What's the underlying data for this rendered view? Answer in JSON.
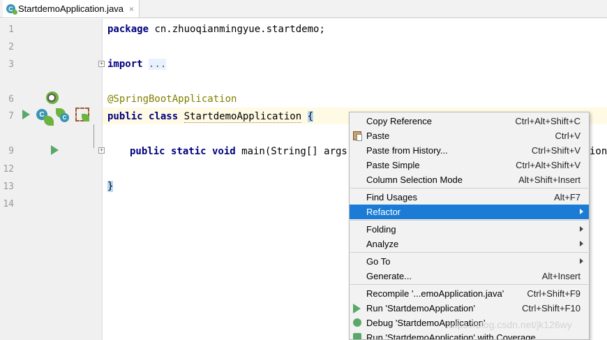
{
  "tab": {
    "title": "StartdemoApplication.java",
    "close": "×"
  },
  "line_numbers": [
    "1",
    "2",
    "3",
    "6",
    "7",
    "9",
    "12",
    "13",
    "14"
  ],
  "code": {
    "l1_kw": "package",
    "l1_rest": " cn.zhuoqianmingyue.startdemo;",
    "l3_kw": "import",
    "l3_fold": "...",
    "l6_ann": "@SpringBootApplication",
    "l7_kw": "public class",
    "l7_name": "StartdemoApplication",
    "l7_brace": "{",
    "l9_kw": "public static void",
    "l9_rest": " main(String[] args",
    "l9_tail": "ion",
    "l13_brace": "}"
  },
  "context_menu": {
    "copy_reference": {
      "label": "Copy Reference",
      "shortcut": "Ctrl+Alt+Shift+C"
    },
    "paste": {
      "label": "Paste",
      "shortcut": "Ctrl+V"
    },
    "paste_history": {
      "label": "Paste from History...",
      "shortcut": "Ctrl+Shift+V"
    },
    "paste_simple": {
      "label": "Paste Simple",
      "shortcut": "Ctrl+Alt+Shift+V"
    },
    "column_selection": {
      "label": "Column Selection Mode",
      "shortcut": "Alt+Shift+Insert"
    },
    "find_usages": {
      "label": "Find Usages",
      "shortcut": "Alt+F7"
    },
    "refactor": {
      "label": "Refactor"
    },
    "folding": {
      "label": "Folding"
    },
    "analyze": {
      "label": "Analyze"
    },
    "go_to": {
      "label": "Go To"
    },
    "generate": {
      "label": "Generate...",
      "shortcut": "Alt+Insert"
    },
    "recompile": {
      "label": "Recompile '...emoApplication.java'",
      "shortcut": "Ctrl+Shift+F9"
    },
    "run": {
      "label": "Run 'StartdemoApplication'",
      "shortcut": "Ctrl+Shift+F10"
    },
    "debug": {
      "label": "Debug 'StartdemoApplication'"
    },
    "coverage": {
      "label": "Run 'StartdemoApplication' with Coverage"
    }
  },
  "watermark": "https://blog.csdn.net/jk126wy",
  "colors": {
    "selection": "#1c7cd5",
    "keyword": "#000080",
    "annotation": "#808000",
    "run_green": "#59a869"
  }
}
